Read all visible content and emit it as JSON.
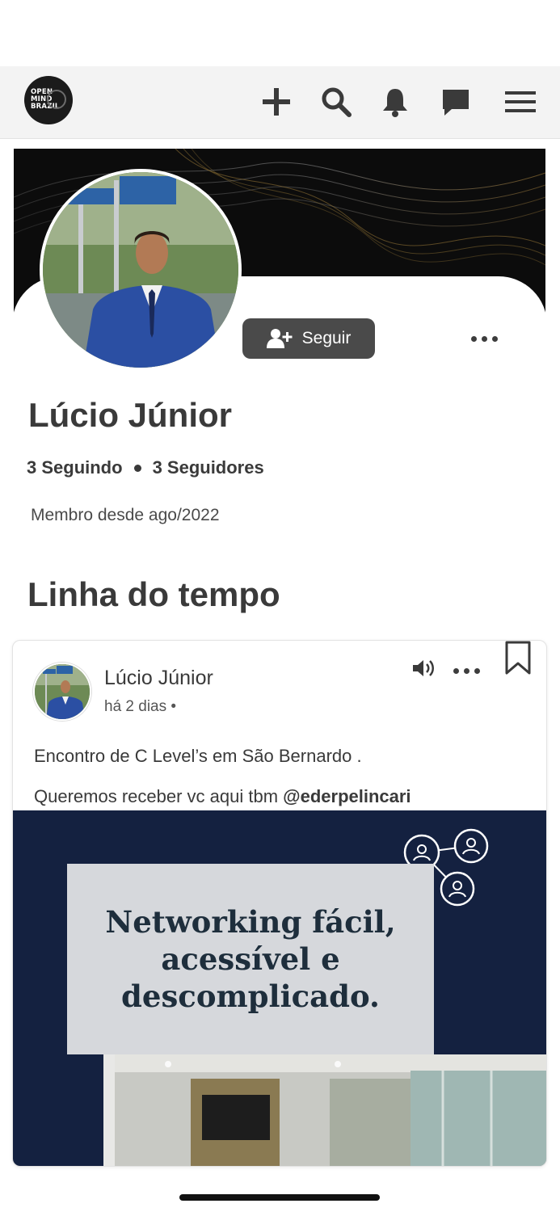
{
  "app": {
    "logo_text": "OPEN MIND BRAZIL"
  },
  "topbar": {
    "icons": [
      "plus-icon",
      "search-icon",
      "bell-icon",
      "chat-icon",
      "menu-icon"
    ]
  },
  "profile": {
    "name": "Lúcio Júnior",
    "follow_label": "Seguir",
    "following": "3 Seguindo",
    "followers": "3 Seguidores",
    "member_since": "Membro desde ago/2022"
  },
  "timeline": {
    "title": "Linha do tempo"
  },
  "post": {
    "author": "Lúcio Júnior",
    "time": "há 2 dias •",
    "text_line1": "Encontro de C Level’s em São Bernardo .",
    "text_line2_prefix": "Queremos receber vc aqui tbm ",
    "mention": "@ederpelincari",
    "image_headline": "Networking fácil, acessível e descomplicado."
  },
  "colors": {
    "topbar_bg": "#f3f3f3",
    "follow_button": "#4a4a4a",
    "image_bg": "#142140",
    "text": "#3a3a3a"
  }
}
